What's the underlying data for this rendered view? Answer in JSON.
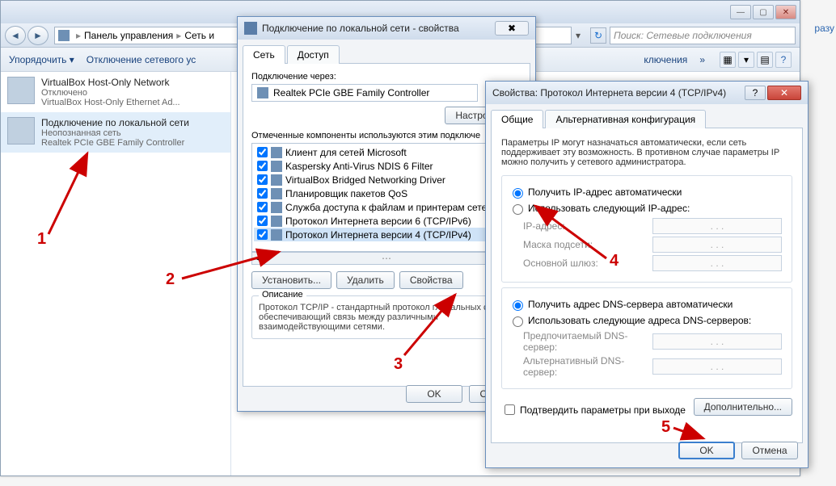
{
  "sideText": "разу",
  "explorer": {
    "nav": {
      "back": "◄",
      "fwd": "►"
    },
    "breadcrumb": {
      "p1": "Панель управления",
      "p2": "Сеть и"
    },
    "searchPlaceholder": "Поиск: Сетевые подключения",
    "toolbar": {
      "organize": "Упорядочить ▾",
      "disable": "Отключение сетевого ус",
      "more": "ключения",
      "chev": "»"
    },
    "conn1": {
      "title": "VirtualBox Host-Only Network",
      "status": "Отключено",
      "adapter": "VirtualBox Host-Only Ethernet Ad..."
    },
    "conn2": {
      "title": "Подключение по локальной сети",
      "status": "Неопознанная сеть",
      "adapter": "Realtek PCIe GBE Family Controller"
    }
  },
  "dlg1": {
    "title": "Подключение по локальной сети - свойства",
    "closeGlyph": "✖",
    "tab1": "Сеть",
    "tab2": "Доступ",
    "connectViaLabel": "Подключение через:",
    "adapter": "Realtek PCIe GBE Family Controller",
    "configureBtn": "Настроить...",
    "componentsLabel": "Отмеченные компоненты используются этим подключе",
    "items": [
      {
        "checked": true,
        "text": "Клиент для сетей Microsoft"
      },
      {
        "checked": true,
        "text": "Kaspersky Anti-Virus NDIS 6 Filter"
      },
      {
        "checked": true,
        "text": "VirtualBox Bridged Networking Driver"
      },
      {
        "checked": true,
        "text": "Планировщик пакетов QoS"
      },
      {
        "checked": true,
        "text": "Служба доступа к файлам и принтерам сетей Mi"
      },
      {
        "checked": true,
        "text": "Протокол Интернета версии 6 (TCP/IPv6)"
      },
      {
        "checked": true,
        "text": "Протокол Интернета версии 4 (TCP/IPv4)"
      }
    ],
    "install": "Установить...",
    "remove": "Удалить",
    "props": "Свойства",
    "descLabel": "Описание",
    "desc": "Протокол TCP/IP - стандартный протокол глобальных сетей, обеспечивающий связь между различными взаимодействующими сетями.",
    "ok": "OK",
    "cancel": "Отмена"
  },
  "dlg2": {
    "title": "Свойства: Протокол Интернета версии 4 (TCP/IPv4)",
    "tab1": "Общие",
    "tab2": "Альтернативная конфигурация",
    "intro": "Параметры IP могут назначаться автоматически, если сеть поддерживает эту возможность. В противном случае параметры IP можно получить у сетевого администратора.",
    "ipAuto": "Получить IP-адрес автоматически",
    "ipManual": "Использовать следующий IP-адрес:",
    "ipAddr": "IP-адрес:",
    "mask": "Маска подсети:",
    "gw": "Основной шлюз:",
    "ipDots": ".       .       .",
    "dnsAuto": "Получить адрес DNS-сервера автоматически",
    "dnsManual": "Использовать следующие адреса DNS-серверов:",
    "dns1": "Предпочитаемый DNS-сервер:",
    "dns2": "Альтернативный DNS-сервер:",
    "confirmExit": "Подтвердить параметры при выходе",
    "advanced": "Дополнительно...",
    "ok": "OK",
    "cancel": "Отмена"
  },
  "annotations": {
    "n1": "1",
    "n2": "2",
    "n3": "3",
    "n4": "4",
    "n5": "5"
  }
}
